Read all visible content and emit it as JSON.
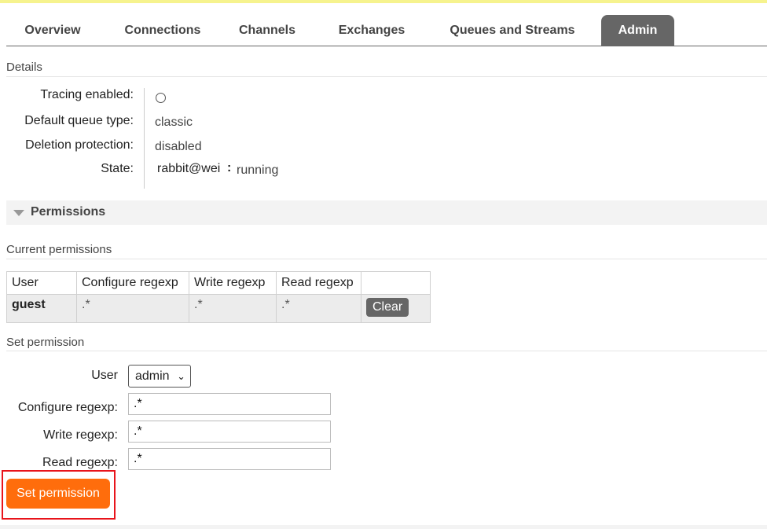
{
  "tabs": [
    "Overview",
    "Connections",
    "Channels",
    "Exchanges",
    "Queues and Streams",
    "Admin"
  ],
  "active_tab": "Admin",
  "details": {
    "heading": "Details",
    "tracing_label": "Tracing enabled:",
    "default_queue_label": "Default queue type:",
    "default_queue_value": "classic",
    "deletion_label": "Deletion protection:",
    "deletion_value": "disabled",
    "state_label": "State:",
    "state_node": "rabbit@wei",
    "state_sep": ":",
    "state_value": "running"
  },
  "permissions": {
    "title": "Permissions",
    "current_heading": "Current permissions",
    "columns": [
      "User",
      "Configure regexp",
      "Write regexp",
      "Read regexp",
      ""
    ],
    "rows": [
      {
        "user": "guest",
        "configure": ".*",
        "write": ".*",
        "read": ".*",
        "action": "Clear"
      }
    ]
  },
  "set_permission": {
    "heading": "Set permission",
    "user_label": "User",
    "user_value": "admin",
    "configure_label": "Configure regexp:",
    "configure_value": ".*",
    "write_label": "Write regexp:",
    "write_value": ".*",
    "read_label": "Read regexp:",
    "read_value": ".*",
    "button_label": "Set permission"
  },
  "colors": {
    "accent_orange": "#ff6d0c",
    "tab_active": "#666666",
    "highlight_red": "#e8141b",
    "top_bar_yellow": "#f6f38e"
  }
}
